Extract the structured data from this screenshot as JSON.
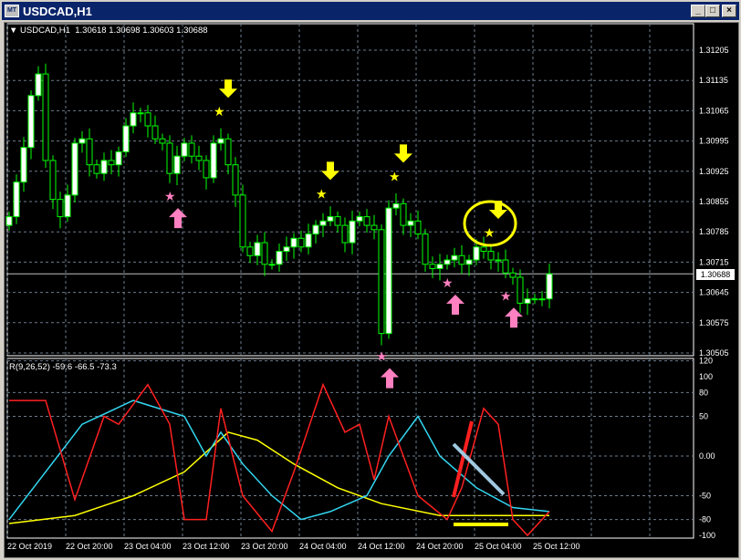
{
  "window": {
    "title": "USDCAD,H1",
    "minimize": "_",
    "maximize": "□",
    "close": "×"
  },
  "info": {
    "symbol": "USDCAD,H1",
    "ohlc": "1.30618 1.30698 1.30603 1.30688"
  },
  "price_axis": {
    "labels": [
      "1.31205",
      "1.31135",
      "1.31065",
      "1.30995",
      "1.30925",
      "1.30855",
      "1.30785",
      "1.30715",
      "1.30645",
      "1.30575",
      "1.30505"
    ],
    "current": "1.30688"
  },
  "indicator": {
    "label": "R(9,26,52) -59.6 -66.5 -73.3",
    "levels": [
      "120",
      "100",
      "80",
      "50",
      "0.00",
      "-50",
      "-80",
      "-100"
    ]
  },
  "time_axis": [
    "22 Oct 2019",
    "22 Oct 20:00",
    "23 Oct 04:00",
    "23 Oct 12:00",
    "23 Oct 20:00",
    "24 Oct 04:00",
    "24 Oct 12:00",
    "24 Oct 20:00",
    "25 Oct 04:00",
    "25 Oct 12:00"
  ],
  "colors": {
    "candle": "#00ff00",
    "bull_body": "#ffffff",
    "bear_body": "#000000",
    "red": "#ff2020",
    "cyan": "#33d6f0",
    "yellow": "#ffff00",
    "pink": "#ff80c0",
    "grid": "#6c7b8b"
  },
  "chart_data": {
    "type": "candlestick",
    "closes": [
      1.3082,
      1.309,
      1.3098,
      1.311,
      1.3115,
      1.3095,
      1.3086,
      1.3082,
      1.3087,
      1.3099,
      1.31,
      1.3094,
      1.3092,
      1.3095,
      1.3094,
      1.3097,
      1.3103,
      1.3106,
      1.3106,
      1.3103,
      1.31,
      1.3099,
      1.3092,
      1.3096,
      1.3099,
      1.3096,
      1.3095,
      1.3091,
      1.3099,
      1.31,
      1.3094,
      1.3087,
      1.3075,
      1.3073,
      1.3076,
      1.3071,
      1.3071,
      1.3074,
      1.3075,
      1.3077,
      1.3075,
      1.3078,
      1.308,
      1.3081,
      1.3082,
      1.308,
      1.3076,
      1.3081,
      1.3082,
      1.308,
      1.3079,
      1.3055,
      1.3084,
      1.3085,
      1.308,
      1.3081,
      1.3078,
      1.3071,
      1.307,
      1.3071,
      1.3072,
      1.3073,
      1.3071,
      1.3072,
      1.3075,
      1.3074,
      1.3072,
      1.3072,
      1.3069,
      1.3068,
      1.3062,
      1.3063,
      1.3063,
      1.3063,
      1.30688
    ],
    "oscillator": {
      "red": [
        [
          0,
          70
        ],
        [
          5,
          70
        ],
        [
          9,
          -55
        ],
        [
          13,
          50
        ],
        [
          15,
          40
        ],
        [
          19,
          90
        ],
        [
          22,
          40
        ],
        [
          24,
          -80
        ],
        [
          27,
          -80
        ],
        [
          29,
          60
        ],
        [
          32,
          -50
        ],
        [
          36,
          -95
        ],
        [
          39,
          -20
        ],
        [
          43,
          90
        ],
        [
          46,
          30
        ],
        [
          48,
          40
        ],
        [
          50,
          -30
        ],
        [
          52,
          50
        ],
        [
          56,
          -50
        ],
        [
          60,
          -80
        ],
        [
          62,
          -40
        ],
        [
          65,
          60
        ],
        [
          67,
          40
        ],
        [
          69,
          -80
        ],
        [
          71,
          -100
        ],
        [
          74,
          -70
        ]
      ],
      "cyan": [
        [
          0,
          -80
        ],
        [
          10,
          40
        ],
        [
          17,
          70
        ],
        [
          24,
          50
        ],
        [
          27,
          0
        ],
        [
          29,
          30
        ],
        [
          32,
          -10
        ],
        [
          36,
          -50
        ],
        [
          40,
          -80
        ],
        [
          44,
          -70
        ],
        [
          49,
          -50
        ],
        [
          52,
          0
        ],
        [
          56,
          50
        ],
        [
          59,
          0
        ],
        [
          64,
          -40
        ],
        [
          69,
          -65
        ],
        [
          74,
          -70
        ]
      ],
      "yellow": [
        [
          0,
          -85
        ],
        [
          9,
          -75
        ],
        [
          17,
          -50
        ],
        [
          24,
          -20
        ],
        [
          30,
          30
        ],
        [
          34,
          20
        ],
        [
          39,
          -10
        ],
        [
          45,
          -40
        ],
        [
          51,
          -60
        ],
        [
          59,
          -75
        ],
        [
          66,
          -75
        ],
        [
          74,
          -75
        ]
      ]
    },
    "signals": {
      "sell_bars": [
        29,
        43,
        53,
        66
      ],
      "buy_bars": [
        22,
        60,
        68,
        51
      ]
    }
  }
}
